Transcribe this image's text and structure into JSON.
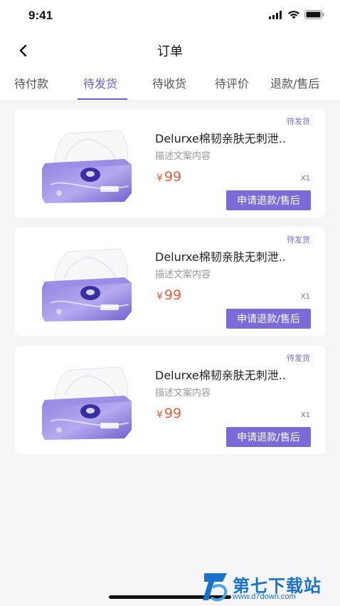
{
  "status_bar": {
    "time": "9:41"
  },
  "nav": {
    "title": "订单"
  },
  "tabs": [
    {
      "label": "待付款",
      "active": false
    },
    {
      "label": "待发货",
      "active": true
    },
    {
      "label": "待收货",
      "active": false
    },
    {
      "label": "待评价",
      "active": false
    },
    {
      "label": "退款/售后",
      "active": false
    }
  ],
  "orders": [
    {
      "status": "待发货",
      "product_name": "Delurxe棉韧亲肤无刺泄..",
      "description": "描述文案内容",
      "currency": "¥",
      "price": "99",
      "quantity": "X1",
      "refund_label": "申请退款/售后"
    },
    {
      "status": "待发货",
      "product_name": "Delurxe棉韧亲肤无刺泄..",
      "description": "描述文案内容",
      "currency": "¥",
      "price": "99",
      "quantity": "X1",
      "refund_label": "申请退款/售后"
    },
    {
      "status": "待发货",
      "product_name": "Delurxe棉韧亲肤无刺泄..",
      "description": "描述文案内容",
      "currency": "¥",
      "price": "99",
      "quantity": "X1",
      "refund_label": "申请退款/售后"
    }
  ],
  "watermark": {
    "title": "第七下载站",
    "url": "www.d7down.com"
  },
  "colors": {
    "accent": "#6a5bd6",
    "button": "#7b6ad8",
    "price": "#e85c3a"
  }
}
